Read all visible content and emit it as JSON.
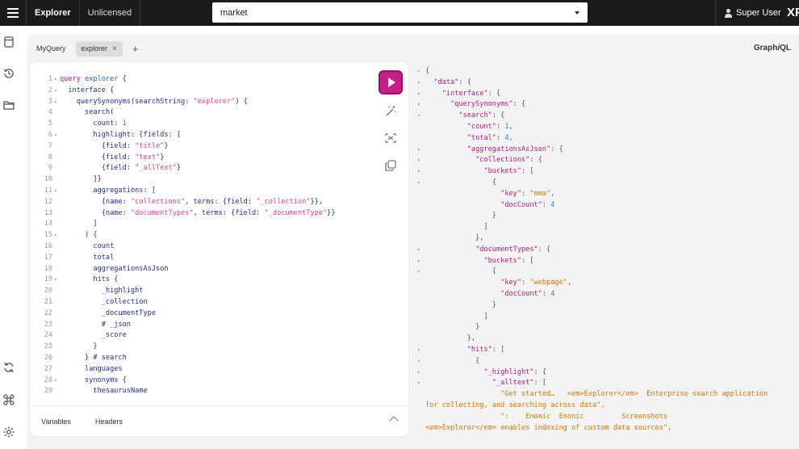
{
  "topbar": {
    "app_title": "Explorer",
    "license": "Unlicensed",
    "repository": "market",
    "user_name": "Super User",
    "logo": "XP"
  },
  "rail": {
    "icons": [
      "document-icon",
      "history-icon",
      "folder-icon",
      "refresh-icon",
      "command-icon",
      "settings-icon"
    ]
  },
  "tabs": {
    "items": [
      "MyQuery",
      "explorer"
    ],
    "active": "explorer",
    "add": "+",
    "close": "×"
  },
  "brand": {
    "graph": "Graph",
    "i": "i",
    "ql": "QL"
  },
  "editor": {
    "lines": [
      {
        "n": "1",
        "f": "▾",
        "t": "query explorer {"
      },
      {
        "n": "2",
        "f": "▾",
        "t": "  interface {"
      },
      {
        "n": "3",
        "f": "▾",
        "t": "    querySynonyms(searchString: \"explorer\") {"
      },
      {
        "n": "4",
        "f": "",
        "t": "      search("
      },
      {
        "n": "5",
        "f": "",
        "t": "        count: 1"
      },
      {
        "n": "6",
        "f": "▾",
        "t": "        highlight: {fields: ["
      },
      {
        "n": "7",
        "f": "",
        "t": "          {field: \"title\"}"
      },
      {
        "n": "8",
        "f": "",
        "t": "          {field: \"text\"}"
      },
      {
        "n": "9",
        "f": "",
        "t": "          {field: \"_allText\"}"
      },
      {
        "n": "10",
        "f": "",
        "t": "        ]}"
      },
      {
        "n": "11",
        "f": "▾",
        "t": "        aggregations: ["
      },
      {
        "n": "12",
        "f": "",
        "t": "          {name: \"collections\", terms: {field: \"_collection\"}},"
      },
      {
        "n": "13",
        "f": "",
        "t": "          {name: \"documentTypes\", terms: {field: \"_documentType\"}}"
      },
      {
        "n": "14",
        "f": "",
        "t": "        ]"
      },
      {
        "n": "15",
        "f": "▾",
        "t": "      ) {"
      },
      {
        "n": "16",
        "f": "",
        "t": "        count"
      },
      {
        "n": "17",
        "f": "",
        "t": "        total"
      },
      {
        "n": "18",
        "f": "",
        "t": "        aggregationsAsJson"
      },
      {
        "n": "19",
        "f": "▾",
        "t": "        hits {"
      },
      {
        "n": "20",
        "f": "",
        "t": "          _highlight"
      },
      {
        "n": "21",
        "f": "",
        "t": "          _collection"
      },
      {
        "n": "22",
        "f": "",
        "t": "          _documentType"
      },
      {
        "n": "23",
        "f": "",
        "t": "          # _json"
      },
      {
        "n": "24",
        "f": "",
        "t": "          _score"
      },
      {
        "n": "25",
        "f": "",
        "t": "        }"
      },
      {
        "n": "26",
        "f": "",
        "t": "      } # search"
      },
      {
        "n": "27",
        "f": "",
        "t": "      languages"
      },
      {
        "n": "28",
        "f": "▾",
        "t": "      synonyms {"
      },
      {
        "n": "29",
        "f": "",
        "t": "        thesaurusName"
      }
    ],
    "footer_tabs": [
      "Variables",
      "Headers"
    ]
  },
  "result": {
    "lines": [
      {
        "f": "▾",
        "t": "{"
      },
      {
        "f": "▾",
        "t": "  \"data\": {"
      },
      {
        "f": "▾",
        "t": "    \"interface\": {"
      },
      {
        "f": "▾",
        "t": "      \"querySynonyms\": {"
      },
      {
        "f": "▾",
        "t": "        \"search\": {"
      },
      {
        "f": "",
        "t": "          \"count\": 1,"
      },
      {
        "f": "",
        "t": "          \"total\": 4,"
      },
      {
        "f": "▾",
        "t": "          \"aggregationsAsJson\": {"
      },
      {
        "f": "▾",
        "t": "            \"collections\": {"
      },
      {
        "f": "▾",
        "t": "              \"buckets\": ["
      },
      {
        "f": "▾",
        "t": "                {"
      },
      {
        "f": "",
        "t": "                  \"key\": \"mma\","
      },
      {
        "f": "",
        "t": "                  \"docCount\": 4"
      },
      {
        "f": "",
        "t": "                }"
      },
      {
        "f": "",
        "t": "              ]"
      },
      {
        "f": "",
        "t": "            },"
      },
      {
        "f": "▾",
        "t": "            \"documentTypes\": {"
      },
      {
        "f": "▾",
        "t": "              \"buckets\": ["
      },
      {
        "f": "▾",
        "t": "                {"
      },
      {
        "f": "",
        "t": "                  \"key\": \"webpage\","
      },
      {
        "f": "",
        "t": "                  \"docCount\": 4"
      },
      {
        "f": "",
        "t": "                }"
      },
      {
        "f": "",
        "t": "              ]"
      },
      {
        "f": "",
        "t": "            }"
      },
      {
        "f": "",
        "t": "          },"
      },
      {
        "f": "▾",
        "t": "          \"hits\": ["
      },
      {
        "f": "▾",
        "t": "            {"
      },
      {
        "f": "▾",
        "t": "              \"_highlight\": {"
      },
      {
        "f": "▾",
        "t": "                \"_alltext\": ["
      },
      {
        "f": "",
        "t": "                  \"Get started…   <em>Explorer</em>  Enterprise search application"
      },
      {
        "f": "",
        "t": "for collecting, and searching across data\","
      },
      {
        "f": "",
        "t": "                  \":    Enonic  Enonic         Screenshots"
      },
      {
        "f": "",
        "t": "<em>Explorer</em> enables indexing of custom data sources\","
      }
    ]
  },
  "colors": {
    "run_button": "#c61f8a",
    "topbar": "#1b1b1b",
    "panel": "#f3f3f3"
  }
}
